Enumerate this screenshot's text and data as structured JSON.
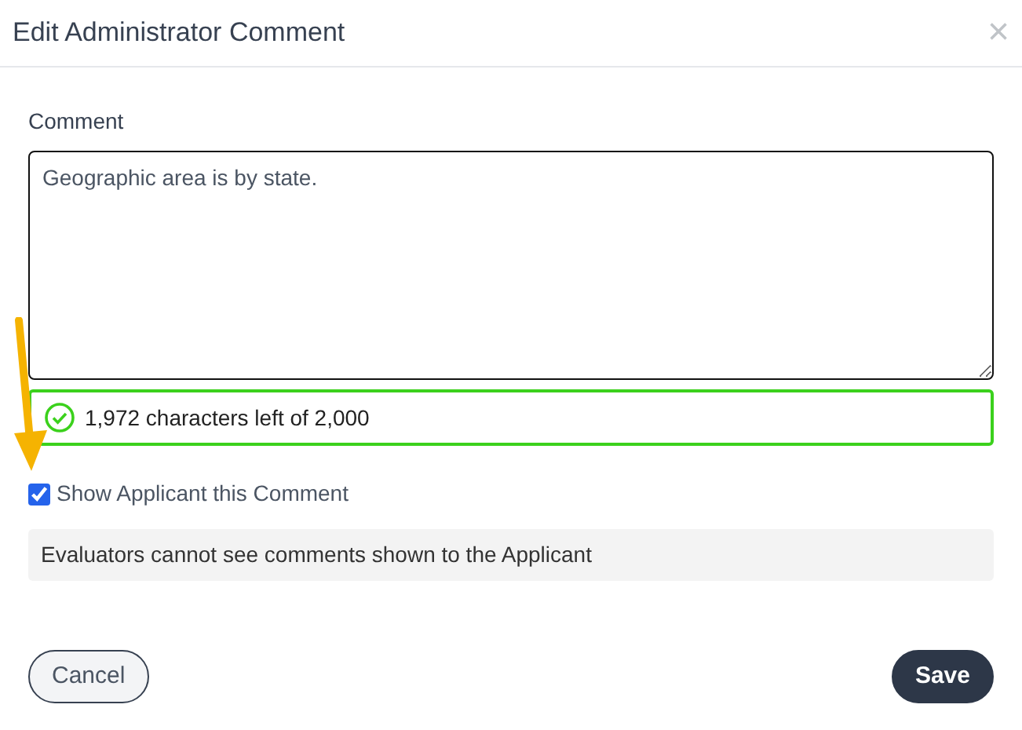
{
  "dialog": {
    "title": "Edit Administrator Comment",
    "close": "×"
  },
  "comment": {
    "label": "Comment",
    "value": "Geographic area is by state.",
    "counter": "1,972 characters left of 2,000",
    "valid": true
  },
  "show_applicant": {
    "label": "Show Applicant this Comment",
    "checked": true
  },
  "note": "Evaluators cannot see comments shown to the Applicant",
  "buttons": [
    {
      "label": "Cancel",
      "kind": "secondary"
    },
    {
      "label": "Save",
      "kind": "primary"
    }
  ]
}
